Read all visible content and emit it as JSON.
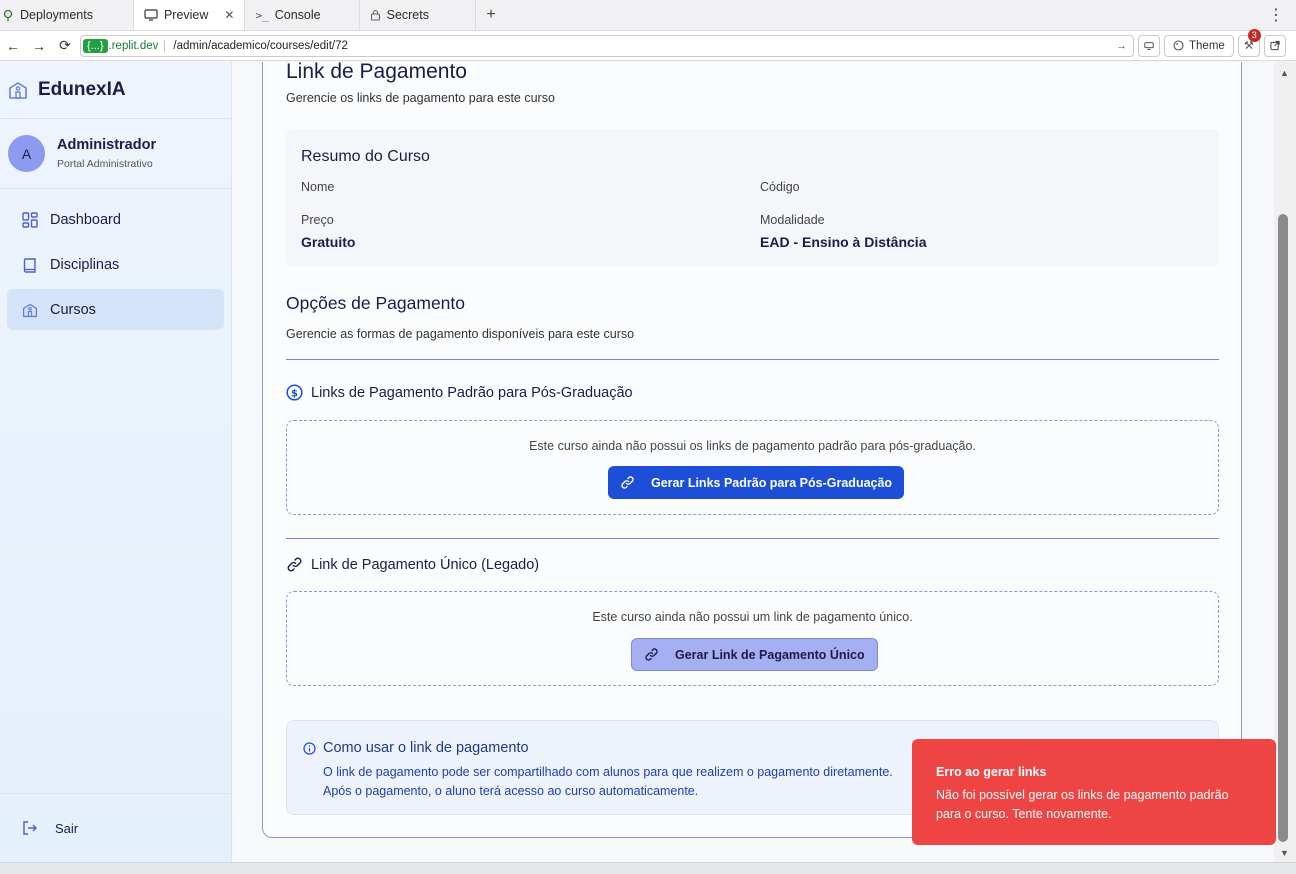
{
  "browser": {
    "tabs": [
      {
        "label": "Deployments",
        "icon": "deployments-icon"
      },
      {
        "label": "Preview",
        "icon": "monitor-icon",
        "active": true
      },
      {
        "label": "Console",
        "icon": "terminal-icon"
      },
      {
        "label": "Secrets",
        "icon": "lock-icon"
      }
    ],
    "new_tab_symbol": "+",
    "menu_symbol": "⋮",
    "url_chip": "{...}",
    "url_host": ".replit.dev",
    "url_path": "/admin/academico/courses/edit/72",
    "theme_label": "Theme",
    "notification_count": "3"
  },
  "sidebar": {
    "brand": "EdunexIA",
    "user_name": "Administrador",
    "user_role": "Portal Administrativo",
    "avatar_initial": "A",
    "items": [
      {
        "label": "Dashboard",
        "icon": "dashboard-icon"
      },
      {
        "label": "Disciplinas",
        "icon": "book-icon"
      },
      {
        "label": "Cursos",
        "icon": "school-icon",
        "active": true
      }
    ],
    "logout_label": "Sair"
  },
  "page": {
    "title": "Link de Pagamento",
    "subtitle": "Gerencie os links de pagamento para este curso",
    "summary": {
      "title": "Resumo do Curso",
      "name_label": "Nome",
      "code_label": "Código",
      "price_label": "Preço",
      "price_value": "Gratuito",
      "modality_label": "Modalidade",
      "modality_value": "EAD - Ensino à Distância"
    },
    "options": {
      "title": "Opções de Pagamento",
      "subtitle": "Gerencie as formas de pagamento disponíveis para este curso"
    },
    "standard": {
      "title": "Links de Pagamento Padrão para Pós-Graduação",
      "empty_text": "Este curso ainda não possui os links de pagamento padrão para pós-graduação.",
      "button_label": "Gerar Links Padrão para Pós-Graduação"
    },
    "single": {
      "title": "Link de Pagamento Único (Legado)",
      "empty_text": "Este curso ainda não possui um link de pagamento único.",
      "button_label": "Gerar Link de Pagamento Único"
    },
    "info": {
      "title": "Como usar o link de pagamento",
      "line1": "O link de pagamento pode ser compartilhado com alunos para que realizem o pagamento diretamente.",
      "line2": "Após o pagamento, o aluno terá acesso ao curso automaticamente."
    }
  },
  "toast": {
    "title": "Erro ao gerar links",
    "description": "Não foi possível gerar os links de pagamento padrão para o curso. Tente novamente."
  },
  "colors": {
    "primary": "#1d4ed8",
    "toast_error": "#ef4444",
    "sidebar_active": "#d5e4f8"
  }
}
